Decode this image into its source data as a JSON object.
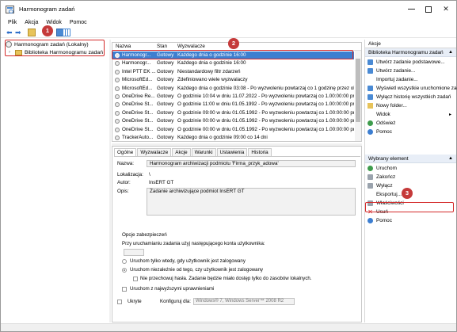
{
  "window": {
    "title": "Harmonogram zadań"
  },
  "menu": [
    "Plik",
    "Akcja",
    "Widok",
    "Pomoc"
  ],
  "tree": {
    "root": "Harmonogram zadań (Lokalny)",
    "child": "Biblioteka Harmonogramu zadań"
  },
  "tasklist": {
    "columns": [
      "Nazwa",
      "Stan",
      "Wyzwalacze"
    ],
    "rows": [
      {
        "name": "Harmonogr...",
        "state": "Gotowy",
        "trigger": "Każdego dnia o godzinie 16:00",
        "selected": true
      },
      {
        "name": "Harmonogr...",
        "state": "Gotowy",
        "trigger": "Każdego dnia o godzinie 16:00",
        "selected": false
      },
      {
        "name": "Intel PTT EK ...",
        "state": "Gotowy",
        "trigger": "Niestandardowy filtr zdarzeń",
        "selected": false
      },
      {
        "name": "MicrosoftEd...",
        "state": "Gotowy",
        "trigger": "Zdefiniowano wiele wyzwalaczy",
        "selected": false
      },
      {
        "name": "MicrosoftEd...",
        "state": "Gotowy",
        "trigger": "Każdego dnia o godzinie 03:08 - Po wyzwoleniu powtarzaj co 1 godzinę przez okr",
        "selected": false
      },
      {
        "name": "OneDrive Re...",
        "state": "Gotowy",
        "trigger": "O godzinie 10:04 w dniu 11.07.2022 - Po wyzwoleniu powtarzaj co 1.00:00:00 prze",
        "selected": false
      },
      {
        "name": "OneDrive St...",
        "state": "Gotowy",
        "trigger": "O godzinie 11:00 w dniu 01.05.1992 - Po wyzwoleniu powtarzaj co 1.00:00:00 prze",
        "selected": false
      },
      {
        "name": "OneDrive St...",
        "state": "Gotowy",
        "trigger": "O godzinie 09:00 w dniu 01.05.1992 - Po wyzwoleniu powtarzaj co 1.00:00:00 prze",
        "selected": false
      },
      {
        "name": "OneDrive St...",
        "state": "Gotowy",
        "trigger": "O godzinie 00:00 w dniu 01.05.1992 - Po wyzwoleniu powtarzaj co 1.00:00:00 prze",
        "selected": false
      },
      {
        "name": "OneDrive St...",
        "state": "Gotowy",
        "trigger": "O godzinie 00:00 w dniu 01.05.1992 - Po wyzwoleniu powtarzaj co 1.00:00:00 prze",
        "selected": false
      },
      {
        "name": "TrackerAuto...",
        "state": "Gotowy",
        "trigger": "Każdego dnia o godzinie 09:00 co 14 dni",
        "selected": false
      }
    ]
  },
  "details": {
    "tabs": [
      "Ogólne",
      "Wyzwalacze",
      "Akcje",
      "Warunki",
      "Ustawienia",
      "Historia"
    ],
    "name_label": "Nazwa:",
    "name_value": "Harmonogram archiwizacji podmiotu 'Firma_przyk_adowa'",
    "location_label": "Lokalizacja:",
    "location_value": "\\",
    "author_label": "Autor:",
    "author_value": "InsERT GT",
    "desc_label": "Opis:",
    "desc_value": "Zadanie archiwizujące podmiot InsERT GT",
    "security_title": "Opcje zabezpieczeń",
    "run_as_label": "Przy uruchamianiu zadania użyj następującego konta użytkownika:",
    "opt_logged_on": "Uruchom tylko wtedy, gdy użytkownik jest zalogowany",
    "opt_whether": "Uruchom niezależnie od tego, czy użytkownik jest zalogowany",
    "opt_no_password": "Nie przechowuj hasła. Zadanie będzie miało dostęp tylko do zasobów lokalnych.",
    "opt_highest": "Uruchom z najwyższymi uprawnieniami",
    "hidden_label": "Ukryte",
    "configure_label": "Konfiguruj dla:",
    "configure_value": "Windows® 7, Windows Server™ 2008 R2"
  },
  "actions": {
    "header": "Akcje",
    "library_header": "Biblioteka Harmonogramu zadań",
    "library_items": [
      {
        "label": "Utwórz zadanie podstawowe...",
        "icon": "blue"
      },
      {
        "label": "Utwórz zadanie...",
        "icon": "blue"
      },
      {
        "label": "Importuj zadanie...",
        "icon": "none"
      },
      {
        "label": "Wyświetl wszystkie uruchomione zadania",
        "icon": "blue"
      },
      {
        "label": "Wyłącz historię wszystkich zadań",
        "icon": "blue"
      },
      {
        "label": "Nowy folder...",
        "icon": "folder"
      },
      {
        "label": "Widok",
        "icon": "none",
        "submenu": true
      },
      {
        "label": "Odśwież",
        "icon": "green"
      },
      {
        "label": "Pomoc",
        "icon": "help"
      }
    ],
    "selected_header": "Wybrany element",
    "selected_items": [
      {
        "label": "Uruchom",
        "icon": "green"
      },
      {
        "label": "Zakończ",
        "icon": "gray"
      },
      {
        "label": "Wyłącz",
        "icon": "gray"
      },
      {
        "label": "Eksportuj...",
        "icon": "none"
      },
      {
        "label": "Właściwości",
        "icon": "gray"
      },
      {
        "label": "Usuń",
        "icon": "red"
      },
      {
        "label": "Pomoc",
        "icon": "help"
      }
    ]
  },
  "markers": [
    "1",
    "2",
    "3"
  ],
  "colors": {
    "selection": "#3d7fd0",
    "callout": "#d42a2a",
    "section_header": "#e8eef7"
  }
}
